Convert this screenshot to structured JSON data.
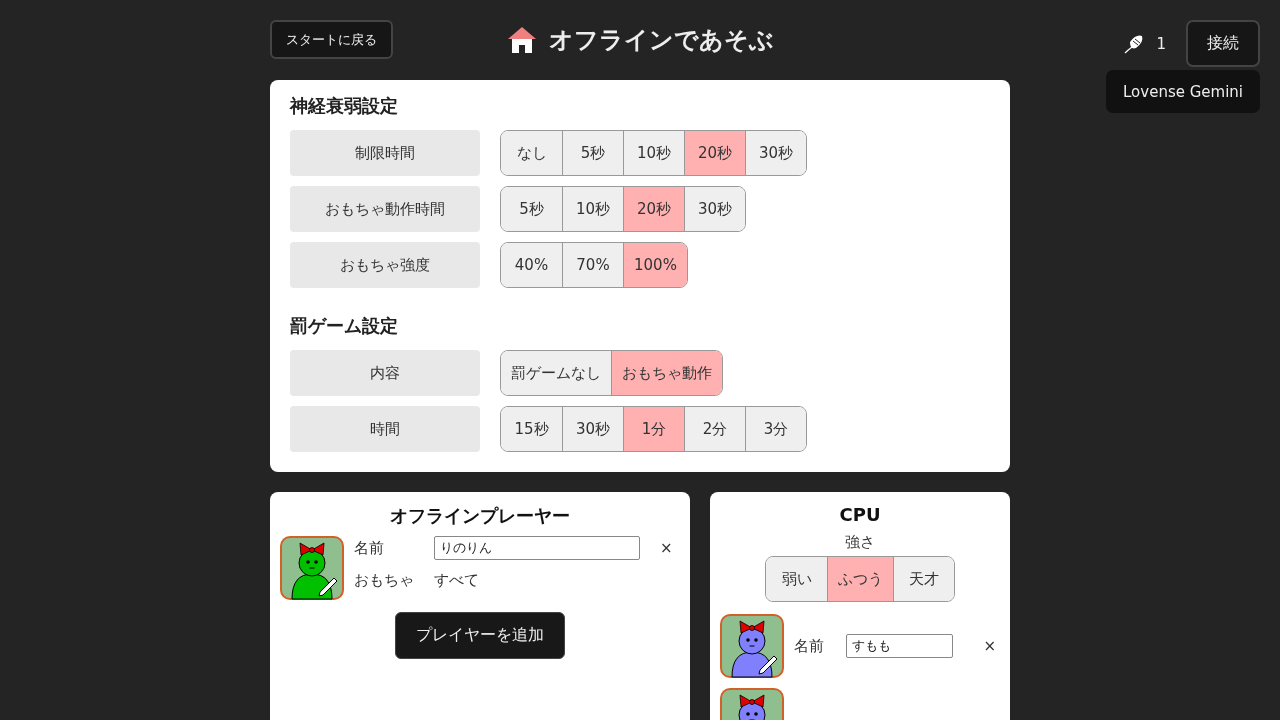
{
  "header": {
    "back_button": "スタートに戻る",
    "title": "オフラインであそぶ",
    "toy_count": "1",
    "connect_button": "接続",
    "device_popup": "Lovense Gemini"
  },
  "settings": [
    {
      "title": "神経衰弱設定",
      "rows": [
        {
          "label": "制限時間",
          "options": [
            {
              "label": "なし",
              "selected": false
            },
            {
              "label": "5秒",
              "selected": false
            },
            {
              "label": "10秒",
              "selected": false
            },
            {
              "label": "20秒",
              "selected": true
            },
            {
              "label": "30秒",
              "selected": false
            }
          ]
        },
        {
          "label": "おもちゃ動作時間",
          "options": [
            {
              "label": "5秒",
              "selected": false
            },
            {
              "label": "10秒",
              "selected": false
            },
            {
              "label": "20秒",
              "selected": true
            },
            {
              "label": "30秒",
              "selected": false
            }
          ]
        },
        {
          "label": "おもちゃ強度",
          "options": [
            {
              "label": "40%",
              "selected": false
            },
            {
              "label": "70%",
              "selected": false
            },
            {
              "label": "100%",
              "selected": true
            }
          ]
        }
      ]
    },
    {
      "title": "罰ゲーム設定",
      "rows": [
        {
          "label": "内容",
          "options": [
            {
              "label": "罰ゲームなし",
              "selected": false
            },
            {
              "label": "おもちゃ動作",
              "selected": true
            }
          ]
        },
        {
          "label": "時間",
          "options": [
            {
              "label": "15秒",
              "selected": false
            },
            {
              "label": "30秒",
              "selected": false
            },
            {
              "label": "1分",
              "selected": true
            },
            {
              "label": "2分",
              "selected": false
            },
            {
              "label": "3分",
              "selected": false
            }
          ]
        }
      ]
    }
  ],
  "offline_players": {
    "title": "オフラインプレーヤー",
    "players": [
      {
        "color": "#00c000",
        "name_label": "名前",
        "name": "りのりん",
        "toy_label": "おもちゃ",
        "toy": "すべて",
        "remove": "×"
      }
    ],
    "add_button": "プレイヤーを追加"
  },
  "cpu": {
    "title": "CPU",
    "strength_label": "強さ",
    "strength_options": [
      {
        "label": "弱い",
        "selected": false
      },
      {
        "label": "ふつう",
        "selected": true
      },
      {
        "label": "天才",
        "selected": false
      }
    ],
    "players": [
      {
        "color": "#8080ff",
        "name_label": "名前",
        "name": "すもも",
        "remove": "×"
      },
      {
        "color": "#8080ff"
      }
    ]
  }
}
